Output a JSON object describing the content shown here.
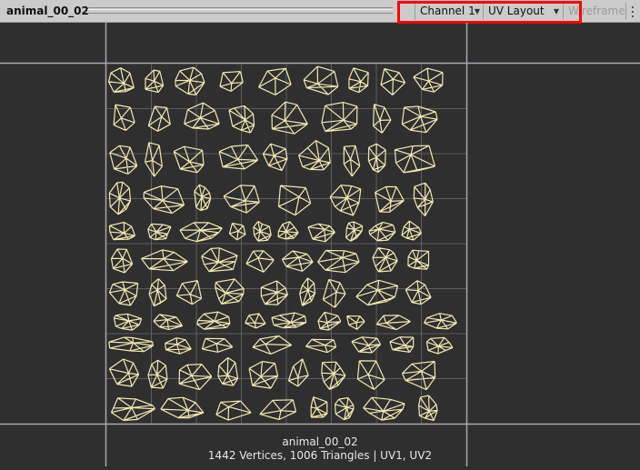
{
  "toolbar": {
    "title": "animal_00_02",
    "channel_label": "Channel 1",
    "mode_label": "UV Layout",
    "wireframe_label": "Wireframe"
  },
  "footer": {
    "mesh_name": "animal_00_02",
    "stats": "1442 Vertices, 1006 Triangles | UV1, UV2"
  },
  "colors": {
    "wire": "#f3e8b4",
    "background": "#2f2f2f",
    "highlight": "#ff0000"
  }
}
